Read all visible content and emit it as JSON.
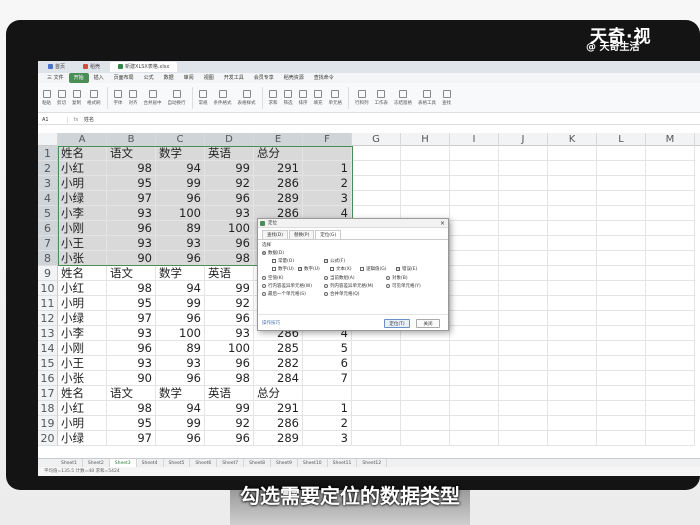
{
  "watermark": {
    "brand": "天奇·视",
    "handle": "@ 天奇生活"
  },
  "subtitle": "勾选需要定位的数据类型",
  "tabs": [
    {
      "label": "首页",
      "color": "#4a74c9"
    },
    {
      "label": "稻壳",
      "color": "#d64b3b"
    },
    {
      "label": "新建XLSX表格.xlsx",
      "color": "#2f8a44",
      "active": true
    }
  ],
  "menus": [
    "三 文件",
    "开始",
    "插入",
    "页面布局",
    "公式",
    "数据",
    "审阅",
    "视图",
    "开发工具",
    "会员专享",
    "稻壳资源",
    "查找命令"
  ],
  "ribbon": [
    "粘贴",
    "剪切",
    "复制",
    "格式刷",
    "字体",
    "对齐",
    "合并居中",
    "自动换行",
    "常规",
    "条件格式",
    "表格样式",
    "求和",
    "筛选",
    "排序",
    "填充",
    "单元格",
    "行和列",
    "工作表",
    "冻结窗格",
    "表格工具",
    "查找"
  ],
  "formula_bar": {
    "cell": "A1",
    "fx": "fx",
    "value": "姓名"
  },
  "columns": [
    "A",
    "B",
    "C",
    "D",
    "E",
    "F",
    "G",
    "H",
    "I",
    "J",
    "K",
    "L",
    "M"
  ],
  "rows": [
    {
      "n": "1",
      "cells": [
        "姓名",
        "语文",
        "数学",
        "英语",
        "总分",
        ""
      ]
    },
    {
      "n": "2",
      "cells": [
        "小红",
        "98",
        "94",
        "99",
        "291",
        "1"
      ]
    },
    {
      "n": "3",
      "cells": [
        "小明",
        "95",
        "99",
        "92",
        "286",
        "2"
      ]
    },
    {
      "n": "4",
      "cells": [
        "小绿",
        "97",
        "96",
        "96",
        "289",
        "3"
      ]
    },
    {
      "n": "5",
      "cells": [
        "小李",
        "93",
        "100",
        "93",
        "286",
        "4"
      ]
    },
    {
      "n": "6",
      "cells": [
        "小刚",
        "96",
        "89",
        "100",
        "285",
        "5"
      ]
    },
    {
      "n": "7",
      "cells": [
        "小王",
        "93",
        "93",
        "96",
        "282",
        "6"
      ]
    },
    {
      "n": "8",
      "cells": [
        "小张",
        "90",
        "96",
        "98",
        "284",
        "7"
      ]
    },
    {
      "n": "9",
      "cells": [
        "姓名",
        "语文",
        "数学",
        "英语",
        "总分",
        ""
      ]
    },
    {
      "n": "10",
      "cells": [
        "小红",
        "98",
        "94",
        "99",
        "291",
        "1"
      ]
    },
    {
      "n": "11",
      "cells": [
        "小明",
        "95",
        "99",
        "92",
        "286",
        "2"
      ]
    },
    {
      "n": "12",
      "cells": [
        "小绿",
        "97",
        "96",
        "96",
        "289",
        "3"
      ]
    },
    {
      "n": "13",
      "cells": [
        "小李",
        "93",
        "100",
        "93",
        "286",
        "4"
      ]
    },
    {
      "n": "14",
      "cells": [
        "小刚",
        "96",
        "89",
        "100",
        "285",
        "5"
      ]
    },
    {
      "n": "15",
      "cells": [
        "小王",
        "93",
        "93",
        "96",
        "282",
        "6"
      ]
    },
    {
      "n": "16",
      "cells": [
        "小张",
        "90",
        "96",
        "98",
        "284",
        "7"
      ]
    },
    {
      "n": "17",
      "cells": [
        "姓名",
        "语文",
        "数学",
        "英语",
        "总分",
        ""
      ]
    },
    {
      "n": "18",
      "cells": [
        "小红",
        "98",
        "94",
        "99",
        "291",
        "1"
      ]
    },
    {
      "n": "19",
      "cells": [
        "小明",
        "95",
        "99",
        "92",
        "286",
        "2"
      ]
    },
    {
      "n": "20",
      "cells": [
        "小绿",
        "97",
        "96",
        "96",
        "289",
        "3"
      ]
    }
  ],
  "dialog": {
    "title": "定位",
    "tabs": [
      "查找(D)",
      "替换(P)",
      "定位(G)"
    ],
    "section": "选择",
    "options": {
      "data": "数据(D)",
      "constant": "常量(O)",
      "formula": "公式(F)",
      "number": "数字(U)",
      "text": "文本(X)",
      "logical": "逻辑值(G)",
      "error": "错误(E)",
      "blank": "空值(K)",
      "current_array": "当前数组(A)",
      "objects": "对象(B)",
      "row_diff": "行内容差异单元格(W)",
      "col_diff": "列内容差异单元格(M)",
      "visible": "可见单元格(Y)",
      "last_cell": "最后一个单元格(S)",
      "merged": "合并单元格(Q)"
    },
    "tip": "操作技巧",
    "locate_button": "定位(T)",
    "close_button": "关闭"
  },
  "sheets": [
    "Sheet1",
    "Sheet2",
    "Sheet3",
    "Sheet4",
    "Sheet5",
    "Sheet6",
    "Sheet7",
    "Sheet8",
    "Sheet9",
    "Sheet10",
    "Sheet11",
    "Sheet12"
  ],
  "active_sheet": "Sheet3",
  "status": "平均值=135.5 计数=48 求和=5424"
}
